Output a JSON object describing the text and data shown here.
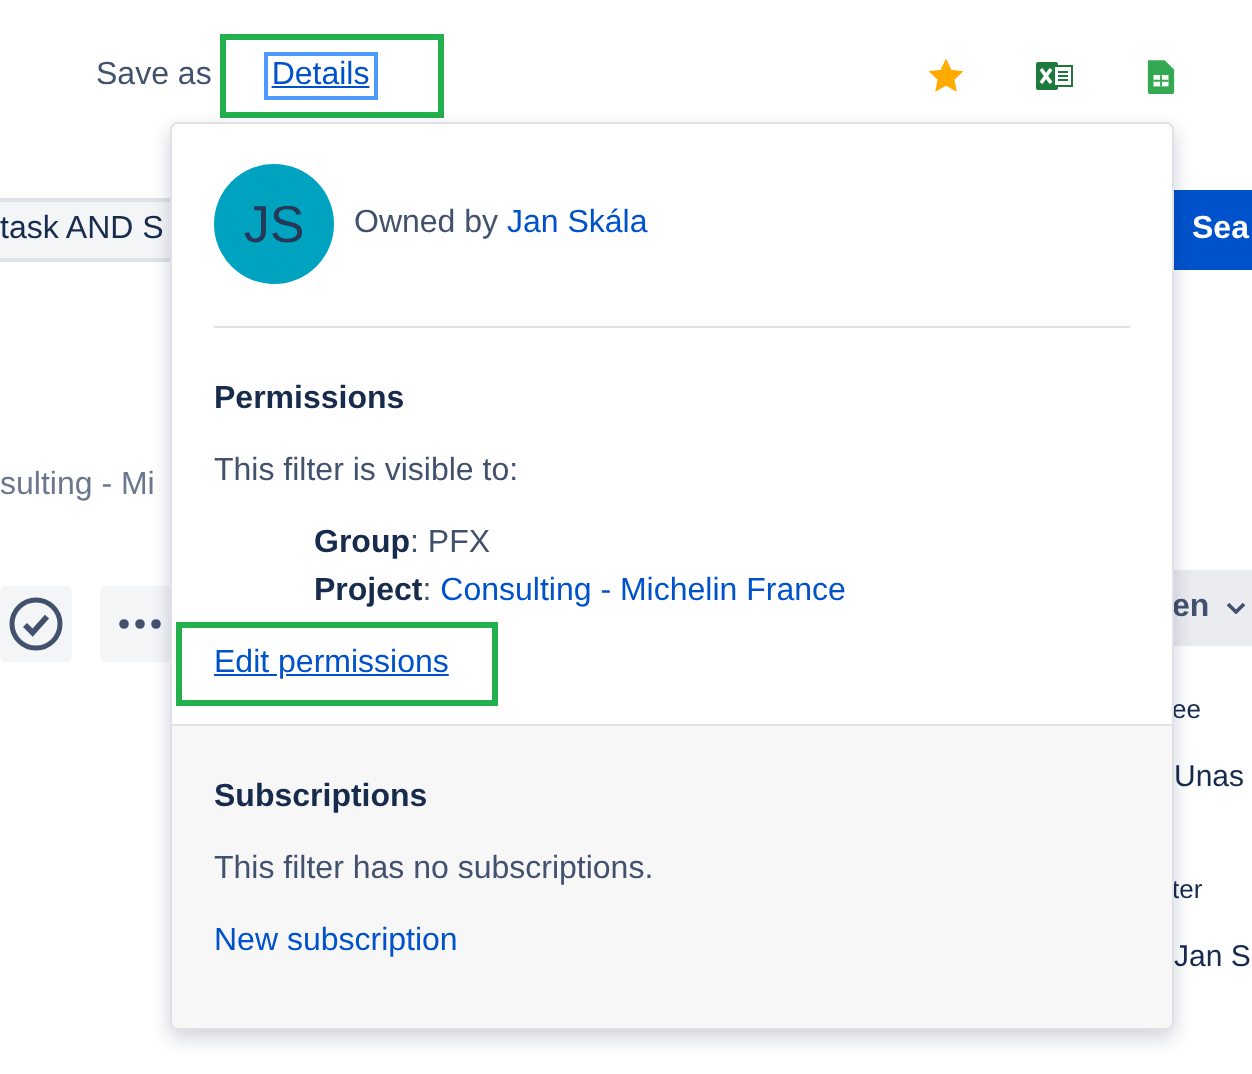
{
  "toolbar": {
    "save_as": "Save as",
    "details": {
      "label": "Details",
      "focused": true,
      "highlighted": true
    }
  },
  "search": {
    "value": "task AND S",
    "button": "Sea"
  },
  "left_column": {
    "project_text": "sulting - Mi"
  },
  "right_column": {
    "view_button": "en",
    "labels": [
      {
        "kind": "heading",
        "text": "ee"
      },
      {
        "kind": "value",
        "text": "Unas"
      },
      {
        "kind": "heading",
        "text": "ter"
      },
      {
        "kind": "value",
        "text": "Jan S"
      }
    ]
  },
  "details_popup": {
    "owner_initials": "JS",
    "owner_label": "Owned by",
    "owner_name": "Jan Skála",
    "permissions": {
      "heading": "Permissions",
      "intro": "This filter is visible to:",
      "entries": [
        {
          "kind": "text",
          "label": "Group",
          "separator": ":",
          "value": "PFX"
        },
        {
          "kind": "link",
          "label": "Project",
          "separator": ":",
          "value": "Consulting - Michelin France"
        }
      ],
      "edit_link": {
        "label": "Edit permissions",
        "highlighted": true
      }
    },
    "subscriptions": {
      "heading": "Subscriptions",
      "note": "This filter has no subscriptions.",
      "new_link": "New subscription"
    }
  }
}
